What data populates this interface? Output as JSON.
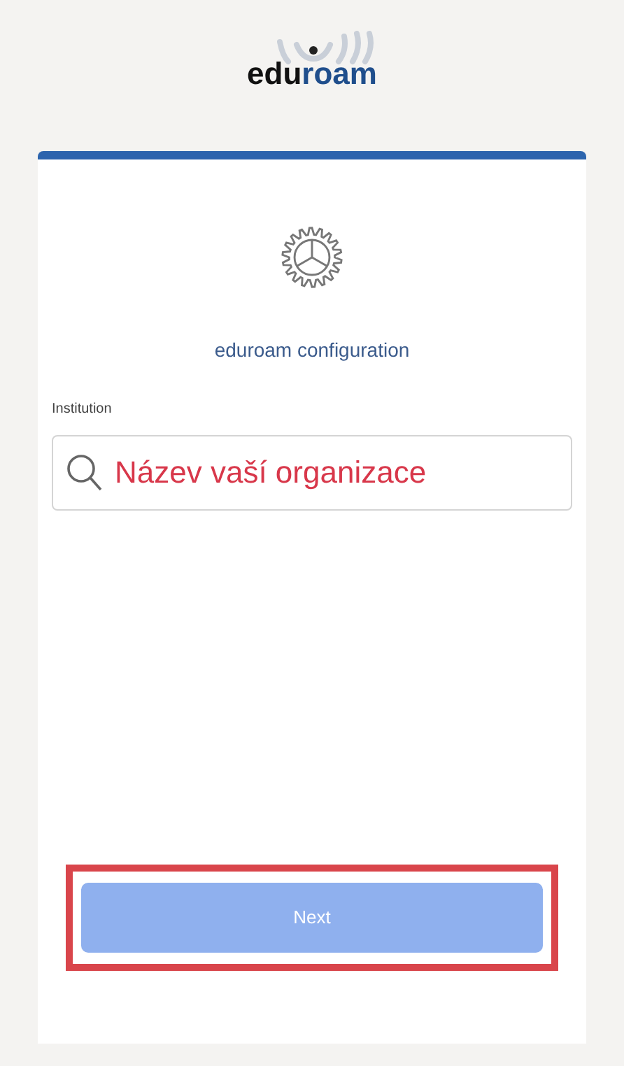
{
  "logo": {
    "parts": [
      "edu",
      "roam"
    ]
  },
  "title": "eduroam configuration",
  "institution": {
    "label": "Institution",
    "value": "Název vaší organizace"
  },
  "next_button": {
    "label": "Next",
    "disabled": true,
    "highlighted": true
  }
}
